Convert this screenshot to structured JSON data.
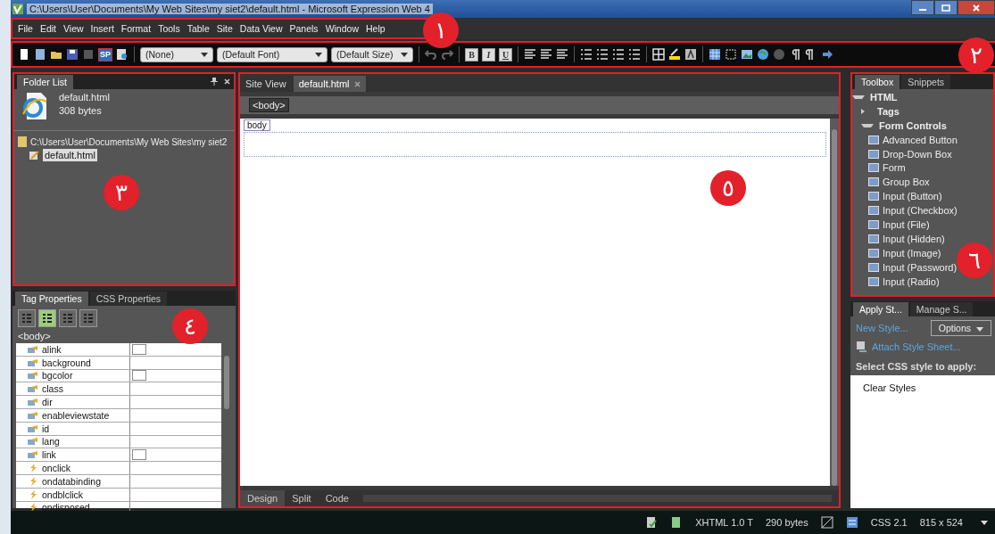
{
  "window": {
    "title": "C:\\Users\\User\\Documents\\My Web Sites\\my siet2\\default.html - Microsoft Expression Web 4"
  },
  "menu": [
    "File",
    "Edit",
    "View",
    "Insert",
    "Format",
    "Tools",
    "Table",
    "Site",
    "Data View",
    "Panels",
    "Window",
    "Help"
  ],
  "toolbar": {
    "sp_label": "SP",
    "style_dropdown": "(None)",
    "font_dropdown": "(Default Font)",
    "size_dropdown": "(Default Size)",
    "format_buttons": [
      "B",
      "I",
      "U"
    ]
  },
  "folder_list": {
    "tab": "Folder List",
    "file_name": "default.html",
    "file_size": "308 bytes",
    "path": "C:\\Users\\User\\Documents\\My Web Sites\\my siet2",
    "items": [
      {
        "label": "default.html",
        "selected": true
      }
    ]
  },
  "tag_properties": {
    "tabs": [
      {
        "label": "Tag Properties",
        "selected": true
      },
      {
        "label": "CSS Properties",
        "selected": false
      }
    ],
    "view_buttons": [
      {
        "selected": false
      },
      {
        "selected": true
      },
      {
        "selected": false
      },
      {
        "selected": false
      }
    ],
    "tag": "<body>",
    "rows": [
      {
        "name": "alink",
        "kind": "attribute",
        "swatch": true
      },
      {
        "name": "background",
        "kind": "attribute",
        "swatch": false
      },
      {
        "name": "bgcolor",
        "kind": "attribute",
        "swatch": true
      },
      {
        "name": "class",
        "kind": "attribute",
        "swatch": false
      },
      {
        "name": "dir",
        "kind": "attribute",
        "swatch": false
      },
      {
        "name": "enableviewstate",
        "kind": "attribute",
        "swatch": false
      },
      {
        "name": "id",
        "kind": "attribute",
        "swatch": false
      },
      {
        "name": "lang",
        "kind": "attribute",
        "swatch": false
      },
      {
        "name": "link",
        "kind": "attribute",
        "swatch": true
      },
      {
        "name": "onclick",
        "kind": "event",
        "swatch": false
      },
      {
        "name": "ondatabinding",
        "kind": "event",
        "swatch": false
      },
      {
        "name": "ondblclick",
        "kind": "event",
        "swatch": false
      },
      {
        "name": "ondisposed",
        "kind": "event",
        "swatch": false
      }
    ]
  },
  "editor": {
    "tabs": [
      {
        "label": "Site View",
        "selected": false
      },
      {
        "label": "default.html",
        "selected": true
      }
    ],
    "breadcrumb": "<body>",
    "body_label": "body",
    "view_tabs": [
      {
        "label": "Design",
        "selected": true
      },
      {
        "label": "Split",
        "selected": false
      },
      {
        "label": "Code",
        "selected": false
      }
    ]
  },
  "toolbox": {
    "tabs": [
      {
        "label": "Toolbox",
        "selected": true
      },
      {
        "label": "Snippets",
        "selected": false
      }
    ],
    "tree": [
      {
        "label": "HTML",
        "expanded": true,
        "children": [
          {
            "label": "Tags",
            "expanded": false
          },
          {
            "label": "Form Controls",
            "expanded": true,
            "children": [
              {
                "label": "Advanced Button"
              },
              {
                "label": "Drop-Down Box"
              },
              {
                "label": "Form"
              },
              {
                "label": "Group Box"
              },
              {
                "label": "Input (Button)"
              },
              {
                "label": "Input (Checkbox)"
              },
              {
                "label": "Input (File)"
              },
              {
                "label": "Input (Hidden)"
              },
              {
                "label": "Input (Image)"
              },
              {
                "label": "Input (Password)"
              },
              {
                "label": "Input (Radio)"
              }
            ]
          }
        ]
      }
    ]
  },
  "apply_styles": {
    "tabs": [
      {
        "label": "Apply St...",
        "selected": true
      },
      {
        "label": "Manage S...",
        "selected": false
      }
    ],
    "new_style": "New Style...",
    "options": "Options",
    "attach": "Attach Style Sheet...",
    "select_label": "Select CSS style to apply:",
    "styles": [
      "Clear Styles"
    ]
  },
  "status_bar": {
    "doctype": "XHTML 1.0 T",
    "size": "290 bytes",
    "css": "CSS 2.1",
    "dimensions": "815 x 524"
  },
  "callouts": [
    "١",
    "٢",
    "٣",
    "٤",
    "٥",
    "٦"
  ]
}
